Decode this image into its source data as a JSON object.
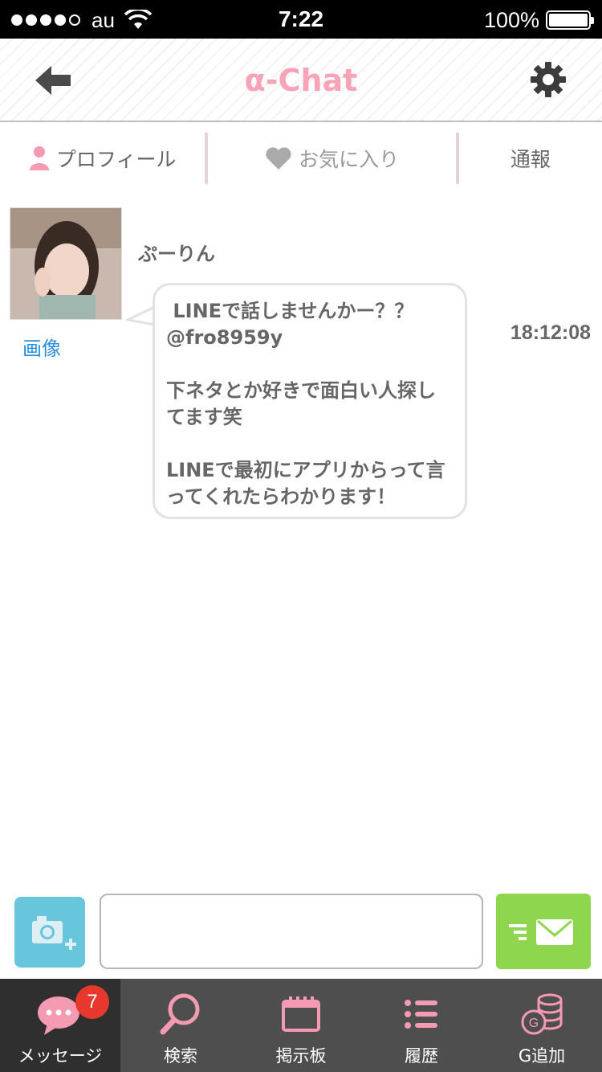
{
  "status_bar": {
    "carrier": "au",
    "time": "7:22",
    "battery_percent": "100%",
    "signal_dots_filled": 4,
    "signal_dots_total": 5
  },
  "header": {
    "title": "α-Chat",
    "back_icon": "back-arrow-icon",
    "settings_icon": "gear-icon"
  },
  "tabs": {
    "profile": "プロフィール",
    "favorite": "お気に入り",
    "report": "通報"
  },
  "message": {
    "sender_name": "ぷーりん",
    "image_link": "画像",
    "text": " LINEで話しませんかー？？\n@fro8959y\n\n下ネタとか好きで面白い人探してます笑\n\nLINEで最初にアプリからって言ってくれたらわかります！",
    "time": "18:12:08"
  },
  "input": {
    "value": "",
    "placeholder": ""
  },
  "bottom_nav": {
    "items": [
      {
        "label": "メッセージ",
        "icon": "speech-bubble-icon",
        "badge": "7"
      },
      {
        "label": "検索",
        "icon": "magnifier-icon"
      },
      {
        "label": "掲示板",
        "icon": "board-icon"
      },
      {
        "label": "履歴",
        "icon": "list-icon"
      },
      {
        "label": "G追加",
        "icon": "coins-icon"
      }
    ]
  },
  "colors": {
    "brand_pink": "#f7a3b8",
    "camera_blue": "#67c6dc",
    "send_green": "#8fd64f",
    "badge_red": "#e8382d",
    "link_blue": "#2a8fe0",
    "nav_bg": "#4e4e4e"
  }
}
